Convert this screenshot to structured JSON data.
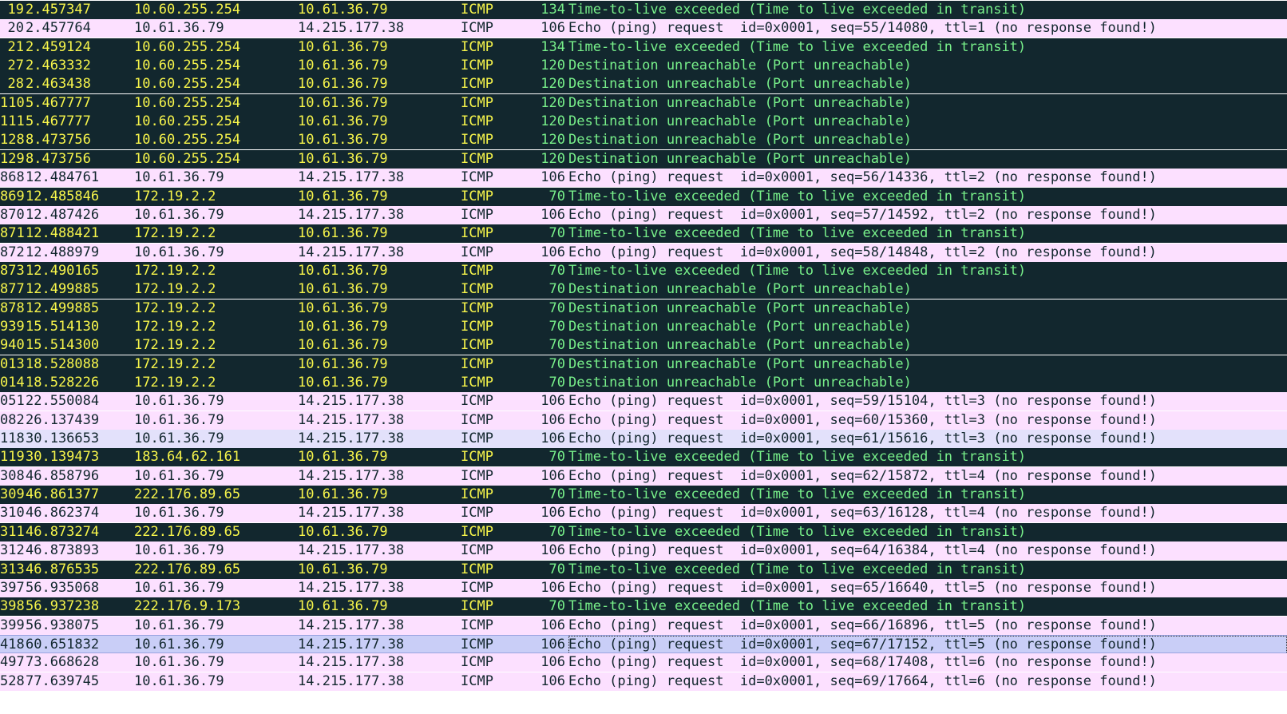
{
  "packets": [
    {
      "no": "19",
      "time": "2.457347",
      "src": "10.60.255.254",
      "dst": "10.61.36.79",
      "proto": "ICMP",
      "len": "134",
      "info": "Time-to-live exceeded (Time to live exceeded in transit)",
      "kind": "ttl"
    },
    {
      "no": "20",
      "time": "2.457764",
      "src": "10.61.36.79",
      "dst": "14.215.177.38",
      "proto": "ICMP",
      "len": "106",
      "info": "Echo (ping) request  id=0x0001, seq=55/14080, ttl=1 (no response found!)",
      "kind": "echo"
    },
    {
      "no": "21",
      "time": "2.459124",
      "src": "10.60.255.254",
      "dst": "10.61.36.79",
      "proto": "ICMP",
      "len": "134",
      "info": "Time-to-live exceeded (Time to live exceeded in transit)",
      "kind": "ttl"
    },
    {
      "no": "27",
      "time": "2.463332",
      "src": "10.60.255.254",
      "dst": "10.61.36.79",
      "proto": "ICMP",
      "len": "120",
      "info": "Destination unreachable (Port unreachable)",
      "kind": "ttl"
    },
    {
      "no": "28",
      "time": "2.463438",
      "src": "10.60.255.254",
      "dst": "10.61.36.79",
      "proto": "ICMP",
      "len": "120",
      "info": "Destination unreachable (Port unreachable)",
      "kind": "ttl"
    },
    {
      "no": "110",
      "time": "5.467777",
      "src": "10.60.255.254",
      "dst": "10.61.36.79",
      "proto": "ICMP",
      "len": "120",
      "info": "Destination unreachable (Port unreachable)",
      "kind": "ttl"
    },
    {
      "no": "111",
      "time": "5.467777",
      "src": "10.60.255.254",
      "dst": "10.61.36.79",
      "proto": "ICMP",
      "len": "120",
      "info": "Destination unreachable (Port unreachable)",
      "kind": "ttl"
    },
    {
      "no": "128",
      "time": "8.473756",
      "src": "10.60.255.254",
      "dst": "10.61.36.79",
      "proto": "ICMP",
      "len": "120",
      "info": "Destination unreachable (Port unreachable)",
      "kind": "ttl"
    },
    {
      "no": "129",
      "time": "8.473756",
      "src": "10.60.255.254",
      "dst": "10.61.36.79",
      "proto": "ICMP",
      "len": "120",
      "info": "Destination unreachable (Port unreachable)",
      "kind": "ttl"
    },
    {
      "no": "868",
      "time": "12.484761",
      "src": "10.61.36.79",
      "dst": "14.215.177.38",
      "proto": "ICMP",
      "len": "106",
      "info": "Echo (ping) request  id=0x0001, seq=56/14336, ttl=2 (no response found!)",
      "kind": "echo"
    },
    {
      "no": "869",
      "time": "12.485846",
      "src": "172.19.2.2",
      "dst": "10.61.36.79",
      "proto": "ICMP",
      "len": "70",
      "info": "Time-to-live exceeded (Time to live exceeded in transit)",
      "kind": "ttl"
    },
    {
      "no": "870",
      "time": "12.487426",
      "src": "10.61.36.79",
      "dst": "14.215.177.38",
      "proto": "ICMP",
      "len": "106",
      "info": "Echo (ping) request  id=0x0001, seq=57/14592, ttl=2 (no response found!)",
      "kind": "echo"
    },
    {
      "no": "871",
      "time": "12.488421",
      "src": "172.19.2.2",
      "dst": "10.61.36.79",
      "proto": "ICMP",
      "len": "70",
      "info": "Time-to-live exceeded (Time to live exceeded in transit)",
      "kind": "ttl"
    },
    {
      "no": "872",
      "time": "12.488979",
      "src": "10.61.36.79",
      "dst": "14.215.177.38",
      "proto": "ICMP",
      "len": "106",
      "info": "Echo (ping) request  id=0x0001, seq=58/14848, ttl=2 (no response found!)",
      "kind": "echo"
    },
    {
      "no": "873",
      "time": "12.490165",
      "src": "172.19.2.2",
      "dst": "10.61.36.79",
      "proto": "ICMP",
      "len": "70",
      "info": "Time-to-live exceeded (Time to live exceeded in transit)",
      "kind": "ttl"
    },
    {
      "no": "877",
      "time": "12.499885",
      "src": "172.19.2.2",
      "dst": "10.61.36.79",
      "proto": "ICMP",
      "len": "70",
      "info": "Destination unreachable (Port unreachable)",
      "kind": "ttl"
    },
    {
      "no": "878",
      "time": "12.499885",
      "src": "172.19.2.2",
      "dst": "10.61.36.79",
      "proto": "ICMP",
      "len": "70",
      "info": "Destination unreachable (Port unreachable)",
      "kind": "ttl"
    },
    {
      "no": "939",
      "time": "15.514130",
      "src": "172.19.2.2",
      "dst": "10.61.36.79",
      "proto": "ICMP",
      "len": "70",
      "info": "Destination unreachable (Port unreachable)",
      "kind": "ttl"
    },
    {
      "no": "940",
      "time": "15.514300",
      "src": "172.19.2.2",
      "dst": "10.61.36.79",
      "proto": "ICMP",
      "len": "70",
      "info": "Destination unreachable (Port unreachable)",
      "kind": "ttl"
    },
    {
      "no": "013",
      "time": "18.528088",
      "src": "172.19.2.2",
      "dst": "10.61.36.79",
      "proto": "ICMP",
      "len": "70",
      "info": "Destination unreachable (Port unreachable)",
      "kind": "ttl"
    },
    {
      "no": "014",
      "time": "18.528226",
      "src": "172.19.2.2",
      "dst": "10.61.36.79",
      "proto": "ICMP",
      "len": "70",
      "info": "Destination unreachable (Port unreachable)",
      "kind": "ttl"
    },
    {
      "no": "051",
      "time": "22.550084",
      "src": "10.61.36.79",
      "dst": "14.215.177.38",
      "proto": "ICMP",
      "len": "106",
      "info": "Echo (ping) request  id=0x0001, seq=59/15104, ttl=3 (no response found!)",
      "kind": "echo"
    },
    {
      "no": "082",
      "time": "26.137439",
      "src": "10.61.36.79",
      "dst": "14.215.177.38",
      "proto": "ICMP",
      "len": "106",
      "info": "Echo (ping) request  id=0x0001, seq=60/15360, ttl=3 (no response found!)",
      "kind": "echo"
    },
    {
      "no": "118",
      "time": "30.136653",
      "src": "10.61.36.79",
      "dst": "14.215.177.38",
      "proto": "ICMP",
      "len": "106",
      "info": "Echo (ping) request  id=0x0001, seq=61/15616, ttl=3 (no response found!)",
      "kind": "echo-alt"
    },
    {
      "no": "119",
      "time": "30.139473",
      "src": "183.64.62.161",
      "dst": "10.61.36.79",
      "proto": "ICMP",
      "len": "70",
      "info": "Time-to-live exceeded (Time to live exceeded in transit)",
      "kind": "ttl"
    },
    {
      "no": "308",
      "time": "46.858796",
      "src": "10.61.36.79",
      "dst": "14.215.177.38",
      "proto": "ICMP",
      "len": "106",
      "info": "Echo (ping) request  id=0x0001, seq=62/15872, ttl=4 (no response found!)",
      "kind": "echo"
    },
    {
      "no": "309",
      "time": "46.861377",
      "src": "222.176.89.65",
      "dst": "10.61.36.79",
      "proto": "ICMP",
      "len": "70",
      "info": "Time-to-live exceeded (Time to live exceeded in transit)",
      "kind": "ttl"
    },
    {
      "no": "310",
      "time": "46.862374",
      "src": "10.61.36.79",
      "dst": "14.215.177.38",
      "proto": "ICMP",
      "len": "106",
      "info": "Echo (ping) request  id=0x0001, seq=63/16128, ttl=4 (no response found!)",
      "kind": "echo"
    },
    {
      "no": "311",
      "time": "46.873274",
      "src": "222.176.89.65",
      "dst": "10.61.36.79",
      "proto": "ICMP",
      "len": "70",
      "info": "Time-to-live exceeded (Time to live exceeded in transit)",
      "kind": "ttl"
    },
    {
      "no": "312",
      "time": "46.873893",
      "src": "10.61.36.79",
      "dst": "14.215.177.38",
      "proto": "ICMP",
      "len": "106",
      "info": "Echo (ping) request  id=0x0001, seq=64/16384, ttl=4 (no response found!)",
      "kind": "echo"
    },
    {
      "no": "313",
      "time": "46.876535",
      "src": "222.176.89.65",
      "dst": "10.61.36.79",
      "proto": "ICMP",
      "len": "70",
      "info": "Time-to-live exceeded (Time to live exceeded in transit)",
      "kind": "ttl"
    },
    {
      "no": "397",
      "time": "56.935068",
      "src": "10.61.36.79",
      "dst": "14.215.177.38",
      "proto": "ICMP",
      "len": "106",
      "info": "Echo (ping) request  id=0x0001, seq=65/16640, ttl=5 (no response found!)",
      "kind": "echo"
    },
    {
      "no": "398",
      "time": "56.937238",
      "src": "222.176.9.173",
      "dst": "10.61.36.79",
      "proto": "ICMP",
      "len": "70",
      "info": "Time-to-live exceeded (Time to live exceeded in transit)",
      "kind": "ttl"
    },
    {
      "no": "399",
      "time": "56.938075",
      "src": "10.61.36.79",
      "dst": "14.215.177.38",
      "proto": "ICMP",
      "len": "106",
      "info": "Echo (ping) request  id=0x0001, seq=66/16896, ttl=5 (no response found!)",
      "kind": "echo"
    },
    {
      "no": "418",
      "time": "60.651832",
      "src": "10.61.36.79",
      "dst": "14.215.177.38",
      "proto": "ICMP",
      "len": "106",
      "info": "Echo (ping) request  id=0x0001, seq=67/17152, ttl=5 (no response found!)",
      "kind": "selected"
    },
    {
      "no": "497",
      "time": "73.668628",
      "src": "10.61.36.79",
      "dst": "14.215.177.38",
      "proto": "ICMP",
      "len": "106",
      "info": "Echo (ping) request  id=0x0001, seq=68/17408, ttl=6 (no response found!)",
      "kind": "echo"
    },
    {
      "no": "528",
      "time": "77.639745",
      "src": "10.61.36.79",
      "dst": "14.215.177.38",
      "proto": "ICMP",
      "len": "106",
      "info": "Echo (ping) request  id=0x0001, seq=69/17664, ttl=6 (no response found!)",
      "kind": "echo"
    }
  ],
  "colors": {
    "ttl_bg": "#12272e",
    "ttl_fg": "#f7f54b",
    "ttl_info_fg": "#78f08a",
    "echo_bg": "#fce0ff",
    "echo_alt_bg": "#e3e1fb",
    "selected_bg": "#c9cef7"
  }
}
